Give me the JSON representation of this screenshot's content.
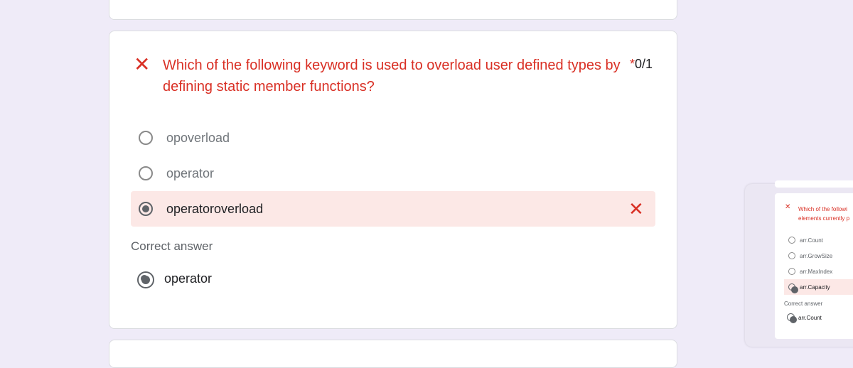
{
  "question": {
    "text_line1": "Which of the following keyword is used to overload user defined types by",
    "text_line2": "defining static member functions?",
    "required_mark": "*",
    "score": "0/1",
    "status_icon": "x-icon",
    "options": [
      {
        "label": "opoverload",
        "selected": false
      },
      {
        "label": "operator",
        "selected": false
      },
      {
        "label": "operatoroverload",
        "selected": true,
        "incorrect": true
      }
    ],
    "correct_answer_label": "Correct answer",
    "correct_answer": "operator"
  },
  "preview": {
    "question_line1": "Which of the followi",
    "question_line2": "elements currently p",
    "options": [
      "arr.Count",
      "arr.GrowSize",
      "arr.MaxIndex",
      "arr.Capacity"
    ],
    "correct_answer_label": "Correct answer",
    "correct_answer": "arr.Count"
  },
  "colors": {
    "error": "#d93025",
    "incorrect_bg": "#fce8e6",
    "background": "#efebf8"
  }
}
